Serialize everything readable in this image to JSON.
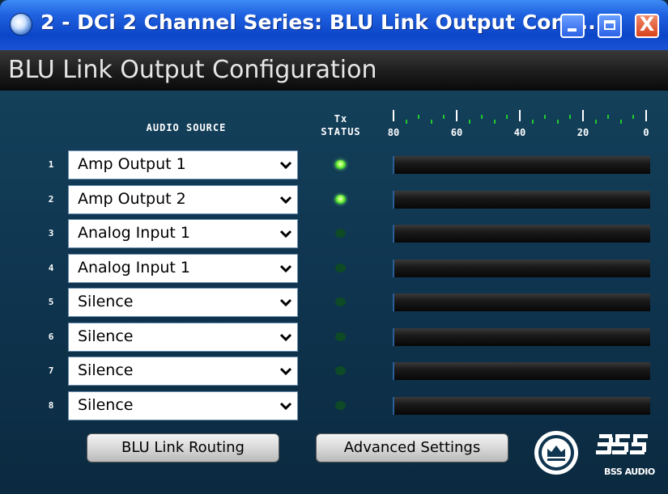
{
  "window": {
    "title": "2 - DCi 2 Channel Series: BLU Link Output Confi...",
    "controls": {
      "minimize": "minimize",
      "maximize": "maximize",
      "close": "X"
    }
  },
  "header": {
    "title": "BLU Link Output Configuration"
  },
  "columns": {
    "audio_source": "AUDIO SOURCE",
    "tx_line1": "Tx",
    "tx_line2": "STATUS"
  },
  "scale": {
    "labels": [
      "80",
      "60",
      "40",
      "20",
      "0"
    ]
  },
  "channels": [
    {
      "number": "1",
      "source": "Amp Output 1",
      "tx_active": true,
      "level": 0
    },
    {
      "number": "2",
      "source": "Amp Output 2",
      "tx_active": true,
      "level": 0
    },
    {
      "number": "3",
      "source": "Analog Input 1",
      "tx_active": false,
      "level": 0
    },
    {
      "number": "4",
      "source": "Analog Input 1",
      "tx_active": false,
      "level": 0
    },
    {
      "number": "5",
      "source": "Silence",
      "tx_active": false,
      "level": 0
    },
    {
      "number": "6",
      "source": "Silence",
      "tx_active": false,
      "level": 0
    },
    {
      "number": "7",
      "source": "Silence",
      "tx_active": false,
      "level": 0
    },
    {
      "number": "8",
      "source": "Silence",
      "tx_active": false,
      "level": 0
    }
  ],
  "buttons": {
    "routing": "BLU Link Routing",
    "advanced": "Advanced Settings"
  },
  "logo": {
    "text": "BSS AUDIO",
    "icon": "bss-crown-logo"
  },
  "colors": {
    "titlebar": "#1f61e0",
    "panel": "#0f3550",
    "led_on": "#3ed12d",
    "led_off": "#0d4a25",
    "meter_accent": "#2b5f9a"
  }
}
